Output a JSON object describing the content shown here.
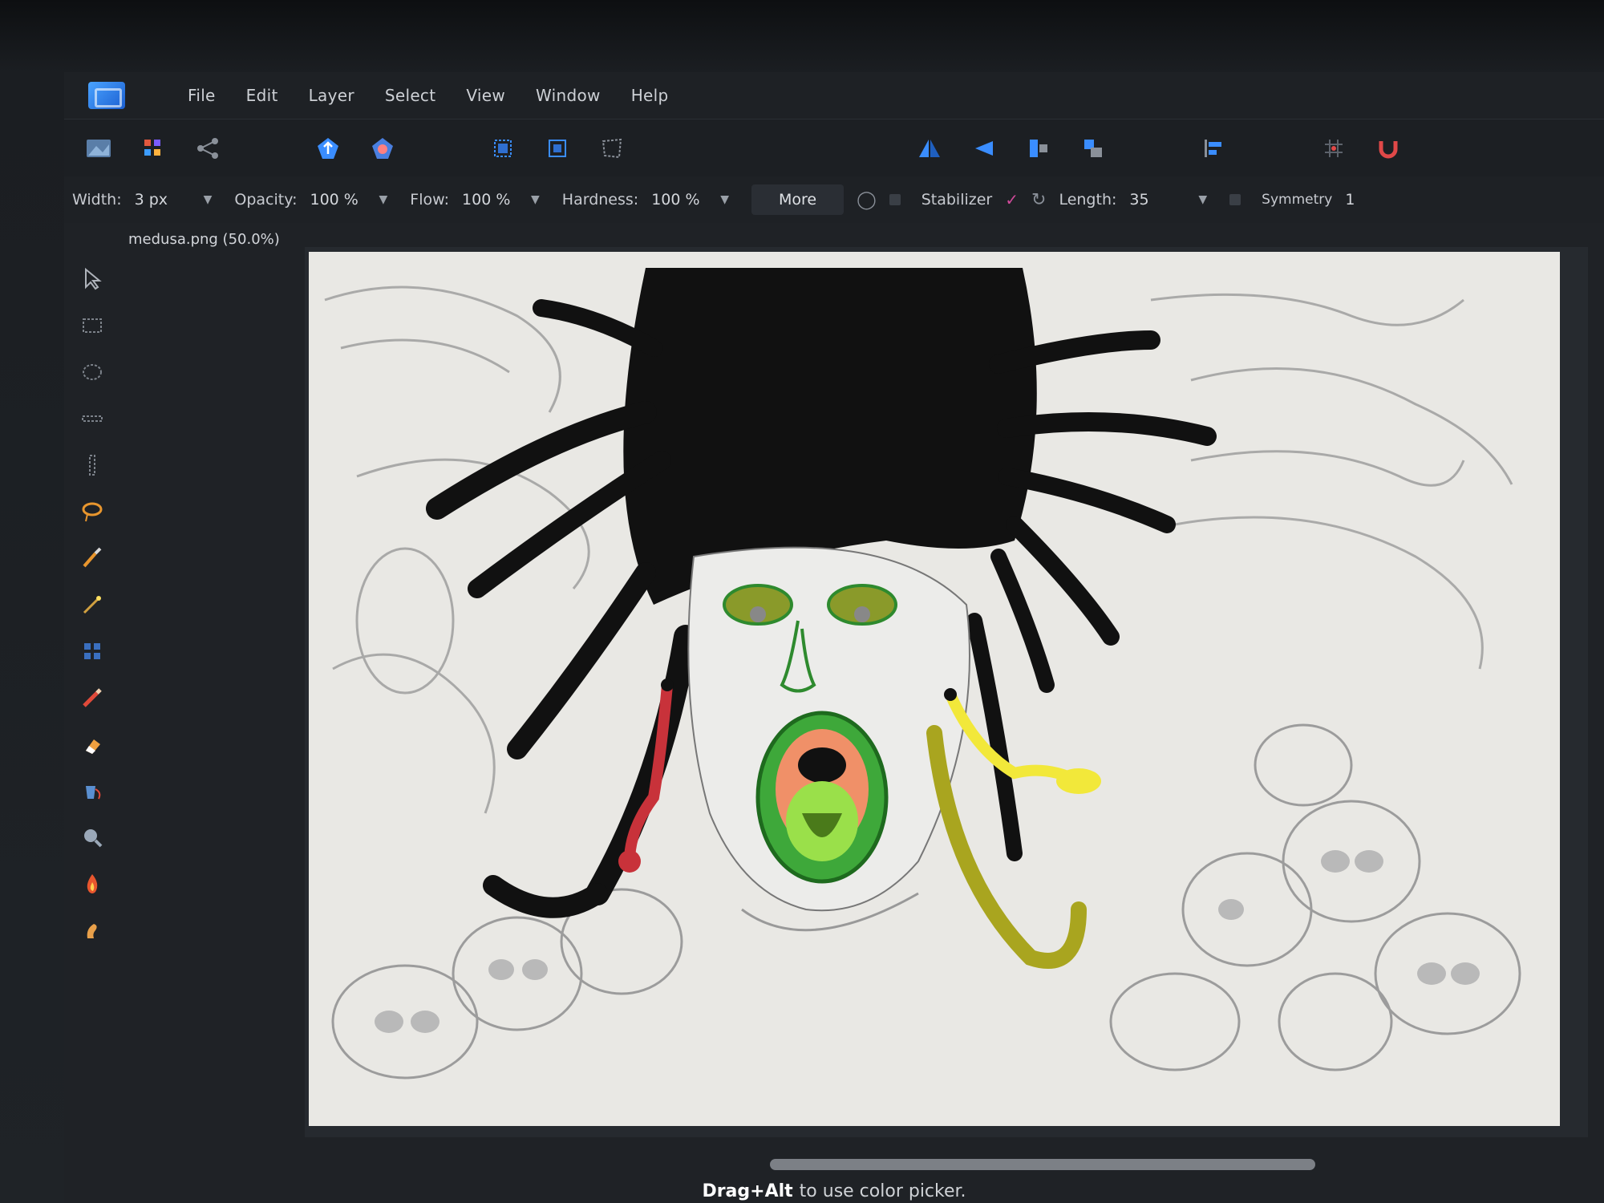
{
  "menu": {
    "items": [
      "File",
      "Edit",
      "Layer",
      "Select",
      "View",
      "Window",
      "Help"
    ]
  },
  "options": {
    "width_label": "Width:",
    "width_value": "3 px",
    "opacity_label": "Opacity:",
    "opacity_value": "100 %",
    "flow_label": "Flow:",
    "flow_value": "100 %",
    "hardness_label": "Hardness:",
    "hardness_value": "100 %",
    "more_label": "More",
    "stabilizer_label": "Stabilizer",
    "length_label": "Length:",
    "length_value": "35",
    "symmetry_label": "Symmetry",
    "symmetry_value": "1"
  },
  "document": {
    "tab_title": "medusa.png (50.0%)"
  },
  "status": {
    "key": "Drag+Alt",
    "hint": "to use color picker."
  },
  "colors": {
    "accent": "#3a8dff",
    "hair": "#111111",
    "skin_green": "#3ea83a",
    "snake_red": "#c8323a",
    "snake_yellow": "#f2e83a",
    "snake_olive": "#a9a51f"
  },
  "icons": {
    "toolbar": [
      "image-icon",
      "grid-icon",
      "share-icon",
      "upload-icon",
      "cloud-icon",
      "crop-icon",
      "transform-icon",
      "flip-horizontal-icon",
      "flip-vertical-icon",
      "align-icon",
      "arrange-icon",
      "snap-icon",
      "magnet-icon"
    ],
    "tools": [
      "move-icon",
      "marquee-icon",
      "lasso-icon",
      "brush-icon",
      "eraser-icon",
      "bucket-icon",
      "zoom-icon"
    ]
  }
}
